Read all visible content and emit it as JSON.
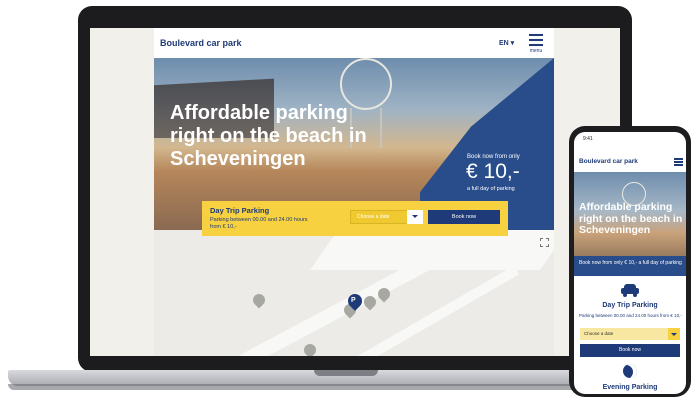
{
  "desktop": {
    "brand": "Boulevard car park",
    "language": "EN",
    "menu_label": "menu",
    "hero_title": "Affordable parking right on the beach in Scheveningen",
    "price_top": "Book now from only",
    "price": "€ 10,-",
    "price_sub": "a full day of parking",
    "booking": {
      "title": "Day Trip Parking",
      "subtitle": "Parking between 00.00 and 24.00 hours from € 10,-",
      "date_placeholder": "Choose a date",
      "book_label": "Book now"
    }
  },
  "mobile": {
    "time": "9:41",
    "brand": "Boulevard car park",
    "hero_title": "Affordable parking right on the beach in Scheveningen",
    "offer": "Book now from only € 10,- a full day of parking",
    "day_title": "Day Trip Parking",
    "day_sub": "Parking between 00.00 and 24.00 hours from € 10,-",
    "date_placeholder": "Choose a date",
    "book_label": "Book now",
    "evening_title": "Evening Parking"
  },
  "icons": {
    "menu": "hamburger-icon",
    "dropdown": "chevron-down-icon",
    "expand": "fullscreen-icon",
    "parking_pin": "parking-pin-icon",
    "car": "car-icon",
    "moon": "moon-icon"
  },
  "map_pin_label": "P",
  "colors": {
    "brand_blue": "#1e3a78",
    "accent_yellow": "#f7d13f",
    "panel_blue": "#284d8a"
  }
}
